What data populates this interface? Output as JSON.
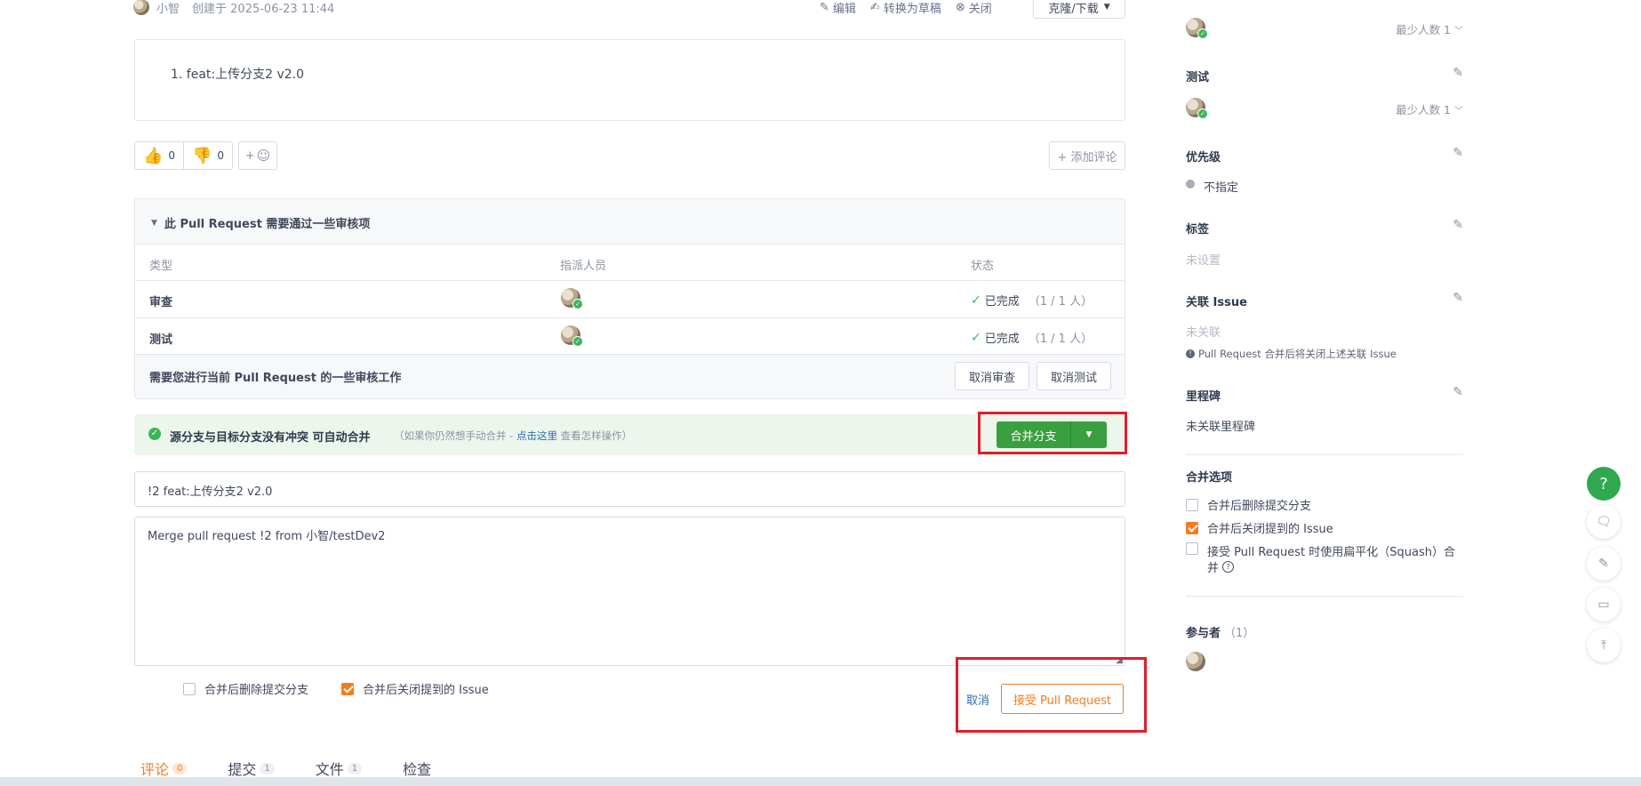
{
  "header": {
    "author": "小智",
    "created": "创建于 2025-06-23 11:44",
    "edit": "编辑",
    "to_draft": "转换为草稿",
    "close": "关闭",
    "clone": "克隆/下载"
  },
  "description": {
    "item": "1. feat:上传分支2 v2.0"
  },
  "reactions": {
    "thumbs_up": "0",
    "thumbs_down": "0",
    "add_emoji": "+",
    "add_comment": "+ 添加评论"
  },
  "review": {
    "title": "此 Pull Request 需要通过一些审核项",
    "columns": [
      "类型",
      "指派人员",
      "状态"
    ],
    "rows": [
      {
        "type": "审查",
        "status": "已完成",
        "count": "（1 / 1 人）"
      },
      {
        "type": "测试",
        "status": "已完成",
        "count": "（1 / 1 人）"
      }
    ],
    "footer_text": "需要您进行当前 Pull Request 的一些审核工作",
    "cancel_review": "取消审查",
    "cancel_test": "取消测试"
  },
  "merge": {
    "status_main": "源分支与目标分支没有冲突 可自动合并",
    "status_pre": "（如果你仍然想手动合并 -",
    "status_link": "点击这里",
    "status_post": "查看怎样操作）",
    "merge_button": "合并分支",
    "title_value": "!2 feat:上传分支2 v2.0",
    "message_value": "Merge pull request !2 from 小智/testDev2",
    "opt_delete": "合并后删除提交分支",
    "opt_close_issue": "合并后关闭提到的 Issue",
    "cancel": "取消",
    "accept": "接受 Pull Request"
  },
  "tabs": [
    {
      "label": "评论",
      "count": "0"
    },
    {
      "label": "提交",
      "count": "1"
    },
    {
      "label": "文件",
      "count": "1"
    },
    {
      "label": "检查"
    }
  ],
  "sidebar": {
    "reviewer_min": "最少人数 1",
    "tester_title": "测试",
    "tester_min": "最少人数 1",
    "priority_title": "优先级",
    "priority_value": "不指定",
    "labels_title": "标签",
    "labels_value": "未设置",
    "issue_title": "关联 Issue",
    "issue_value": "未关联",
    "issue_note": "Pull Request 合并后将关闭上述关联 Issue",
    "milestone_title": "里程碑",
    "milestone_value": "未关联里程碑",
    "merge_opts_title": "合并选项",
    "merge_opt1": "合并后删除提交分支",
    "merge_opt2": "合并后关闭提到的 Issue",
    "merge_opt3a": "接受 Pull Request 时使用扁平化（Squash）合",
    "merge_opt3b": "并",
    "participants_title": "参与者",
    "participants_count": "（1）"
  },
  "float": {
    "help": "?"
  },
  "colors": {
    "accent": "#f37c20",
    "success": "#3ab65a",
    "merge_green": "#3a9f3f",
    "link": "#2d6cb5",
    "highlight": "#e11d2a"
  }
}
